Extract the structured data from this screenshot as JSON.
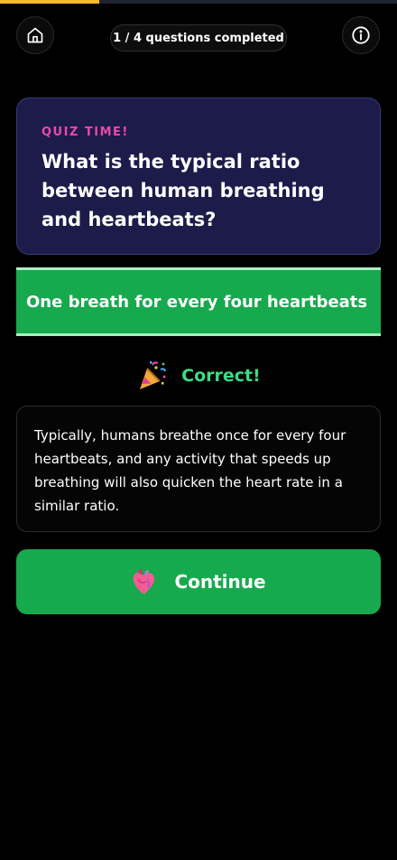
{
  "progress": {
    "completed_fraction": 0.25,
    "fill_color": "#f5b829",
    "track_color": "#1f2430"
  },
  "header": {
    "home_icon": "home-icon",
    "status_text": "1 / 4 questions completed",
    "info_icon": "info-icon"
  },
  "question": {
    "label": "QUIZ TIME!",
    "text": "What is the typical ratio between human breathing and heartbeats?",
    "label_color": "#e84aa8",
    "card_color": "#1d1b4a"
  },
  "answer": {
    "selected_text": "One breath for every four heartbeats",
    "state": "correct",
    "color": "#17a94d"
  },
  "result": {
    "icon": "party-popper-icon",
    "text": "Correct!",
    "color": "#3ddc84"
  },
  "explanation": {
    "text": "Typically, humans breathe once for every four heartbeats, and any activity that speeds up breathing will also quicken the heart rate in a similar ratio."
  },
  "continue_button": {
    "icon": "anatomical-heart-icon",
    "label": "Continue",
    "color": "#17a94d"
  }
}
